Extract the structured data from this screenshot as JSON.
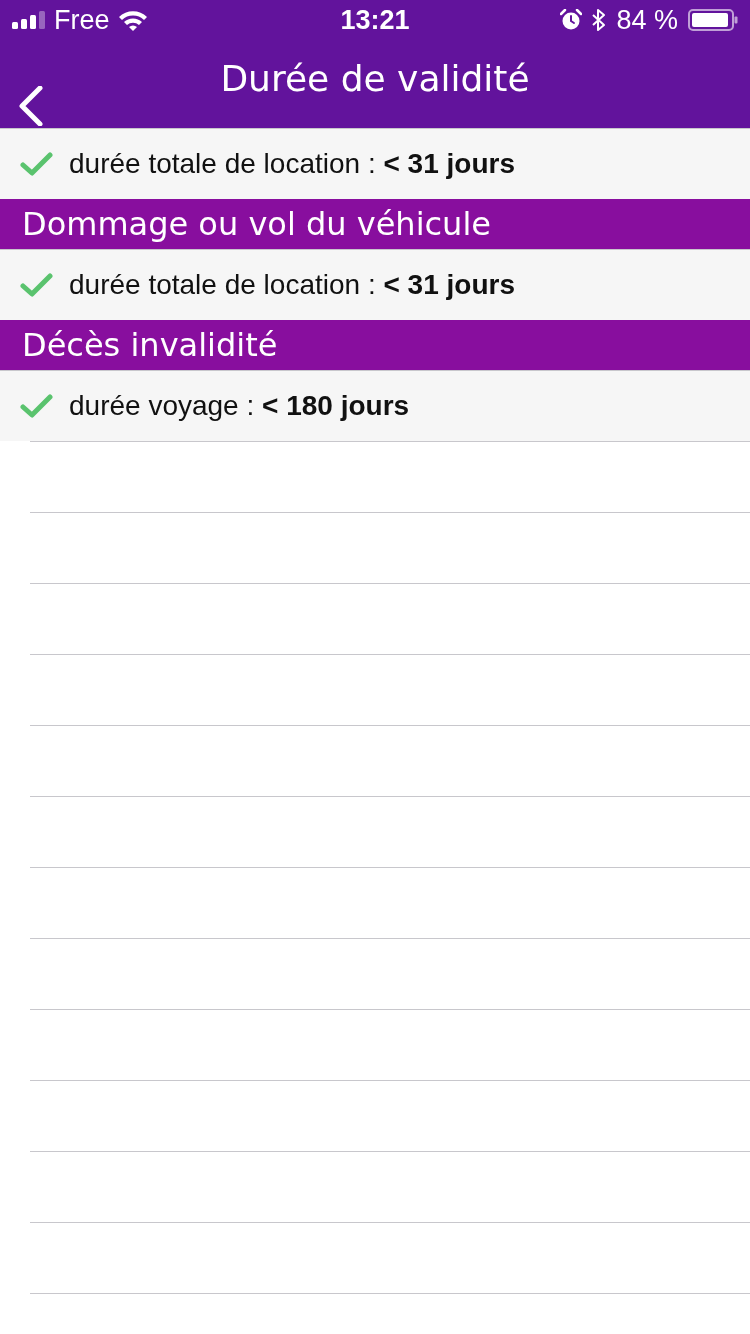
{
  "status_bar": {
    "carrier": "Free",
    "time": "13:21",
    "battery": "84 %"
  },
  "nav_bar": {
    "title": "Durée de validité"
  },
  "sections": [
    {
      "rows": [
        {
          "text": "durée totale de location : **< 31 jours**"
        }
      ]
    },
    {
      "title": "Dommage ou vol du véhicule",
      "rows": [
        {
          "text": "durée totale de location : **< 31 jours**"
        }
      ]
    },
    {
      "title": "Décès invalidité",
      "rows": [
        {
          "text": "durée voyage : **< 180 jours**"
        }
      ]
    }
  ]
}
